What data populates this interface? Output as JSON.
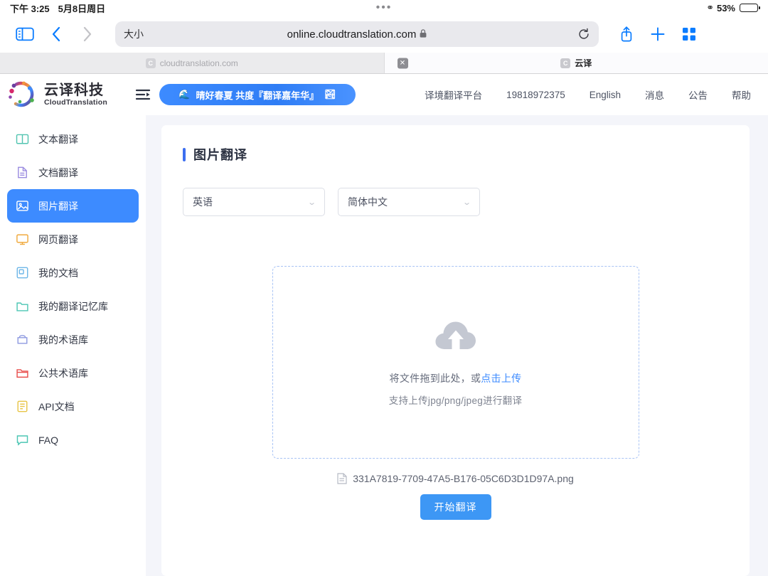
{
  "status_bar": {
    "time": "下午 3:25",
    "date": "5月8日周日",
    "battery_percent": "53%",
    "glasses_icon": "eye-glasses-icon"
  },
  "browser": {
    "sidebar_icon": "sidebar-toggle-icon",
    "back_icon": "chevron-left-icon",
    "forward_icon": "chevron-right-icon",
    "size_label": "大小",
    "url": "online.cloudtranslation.com",
    "lock_icon": "lock-icon",
    "reload_icon": "reload-icon",
    "share_icon": "share-icon",
    "new_tab_icon": "plus-icon",
    "tabs_overview_icon": "grid-icon",
    "tabs": [
      {
        "title": "cloudtranslation.com",
        "favicon_letter": "C",
        "active": false
      },
      {
        "title": "云译",
        "favicon_letter": "C",
        "active": true,
        "close_label": "✕"
      }
    ]
  },
  "site": {
    "logo": {
      "cn": "云译科技",
      "en": "CloudTranslation",
      "icon": "cloud-translation-logo"
    },
    "collapse_icon": "menu-collapse-icon",
    "promo": {
      "text": "晴好春夏 共度『翻译嘉年华』",
      "left_icon": "🌊",
      "right_icon": "🏞",
      "color": "#3d8bff"
    },
    "nav": [
      {
        "label": "译境翻译平台"
      },
      {
        "label": "19818972375"
      },
      {
        "label": "English"
      },
      {
        "label": "消息"
      },
      {
        "label": "公告"
      },
      {
        "label": "帮助"
      }
    ]
  },
  "sidebar": {
    "items": [
      {
        "label": "文本翻译",
        "icon": "book-icon",
        "color": "#52c4b0",
        "active": false
      },
      {
        "label": "文档翻译",
        "icon": "document-icon",
        "color": "#9b8ce0",
        "active": false
      },
      {
        "label": "图片翻译",
        "icon": "image-icon",
        "color": "#ffffff",
        "active": true
      },
      {
        "label": "网页翻译",
        "icon": "monitor-icon",
        "color": "#f0a93c",
        "active": false
      },
      {
        "label": "我的文档",
        "icon": "files-icon",
        "color": "#6fb7e8",
        "active": false
      },
      {
        "label": "我的翻译记忆库",
        "icon": "folder-icon",
        "color": "#4cc6b4",
        "active": false
      },
      {
        "label": "我的术语库",
        "icon": "archive-icon",
        "color": "#8e9ae0",
        "active": false
      },
      {
        "label": "公共术语库",
        "icon": "folder-open-icon",
        "color": "#e8504e",
        "active": false
      },
      {
        "label": "API文档",
        "icon": "list-doc-icon",
        "color": "#e8c547",
        "active": false
      },
      {
        "label": "FAQ",
        "icon": "chat-icon",
        "color": "#4cc6b4",
        "active": false
      }
    ],
    "active_bg": "#3d8bff"
  },
  "main": {
    "title": "图片翻译",
    "source_language": "英语",
    "target_language": "简体中文",
    "dropzone": {
      "icon": "cloud-upload-icon",
      "text_prefix": "将文件拖到此处，或",
      "link_text": "点击上传",
      "hint": "支持上传jpg/png/jpeg进行翻译"
    },
    "uploaded_file": {
      "icon": "file-icon",
      "name": "331A7819-7709-47A5-B176-05C6D3D1D97A.png"
    },
    "start_button": "开始翻译",
    "accent_color": "#3d97f5"
  }
}
